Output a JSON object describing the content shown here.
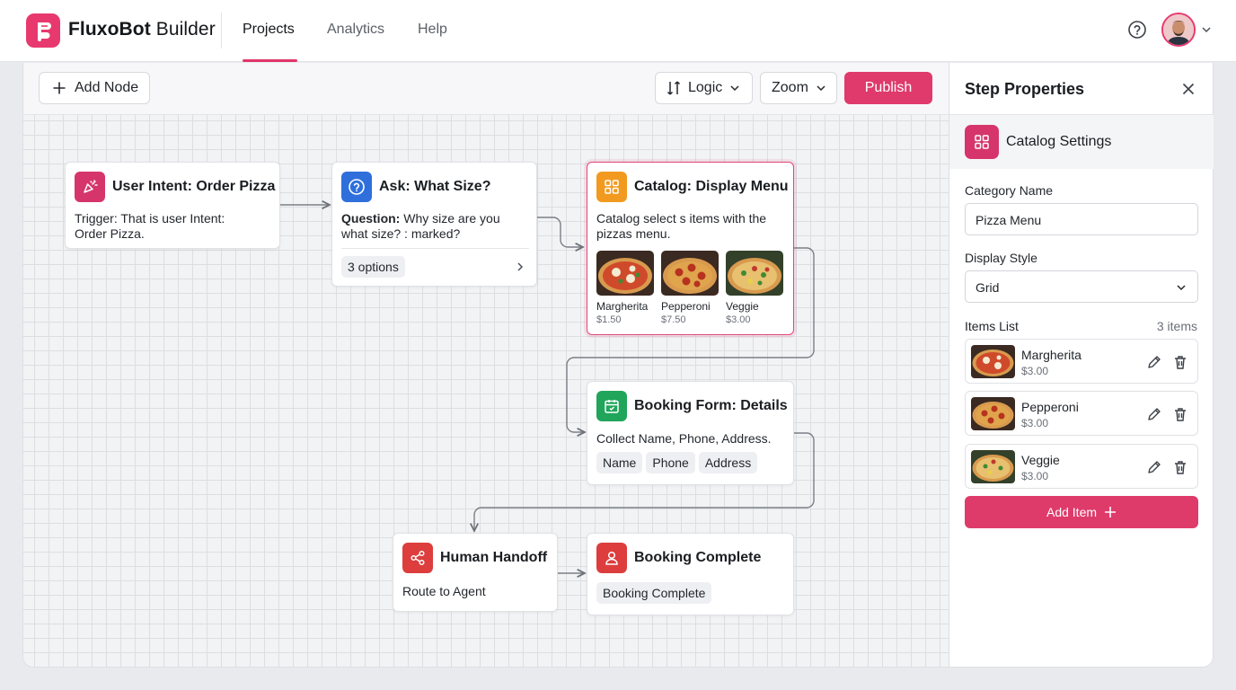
{
  "app": {
    "brand_bold": "FluxoBot",
    "brand_rest": " Builder",
    "nav": [
      "Projects",
      "Analytics",
      "Help"
    ],
    "accent": "#e0366a"
  },
  "toolbar": {
    "add_node": "Add Node",
    "logic": "Logic",
    "zoom": "Zoom",
    "publish": "Publish"
  },
  "nodes": {
    "intent": {
      "title": "User Intent: Order Pizza",
      "body_bold": "Trigger:",
      "body": " That is user Intent: Order Pizza."
    },
    "ask": {
      "title": "Ask: What Size?",
      "body_bold": "Question:",
      "body": " Why size are you what size? : marked?",
      "options": "3 options"
    },
    "catalog": {
      "title": "Catalog: Display Menu",
      "body": "Catalog select s items with the pizzas menu.",
      "items": [
        {
          "name": "Margherita",
          "price": "$1.50"
        },
        {
          "name": "Pepperoni",
          "price": "$7.50"
        },
        {
          "name": "Veggie",
          "price": "$3.00"
        }
      ]
    },
    "booking": {
      "title": "Booking Form: Details",
      "body": "Collect Name, Phone, Address.",
      "fields": [
        "Name",
        "Phone",
        "Address"
      ]
    },
    "handoff": {
      "title": "Human Handoff",
      "body": "Route to Agent"
    },
    "complete": {
      "title": "Booking Complete",
      "chip": "Booking Complete"
    }
  },
  "properties": {
    "title": "Step Properties",
    "section": "Catalog Settings",
    "category_label": "Category Name",
    "category_value": "Pizza Menu",
    "style_label": "Display Style",
    "style_value": "Grid",
    "items_label": "Items List",
    "items_count": "3 items",
    "items": [
      {
        "name": "Margherita",
        "price": "$3.00"
      },
      {
        "name": "Pepperoni",
        "price": "$3.00"
      },
      {
        "name": "Veggie",
        "price": "$3.00"
      }
    ],
    "add_item": "Add Item"
  }
}
